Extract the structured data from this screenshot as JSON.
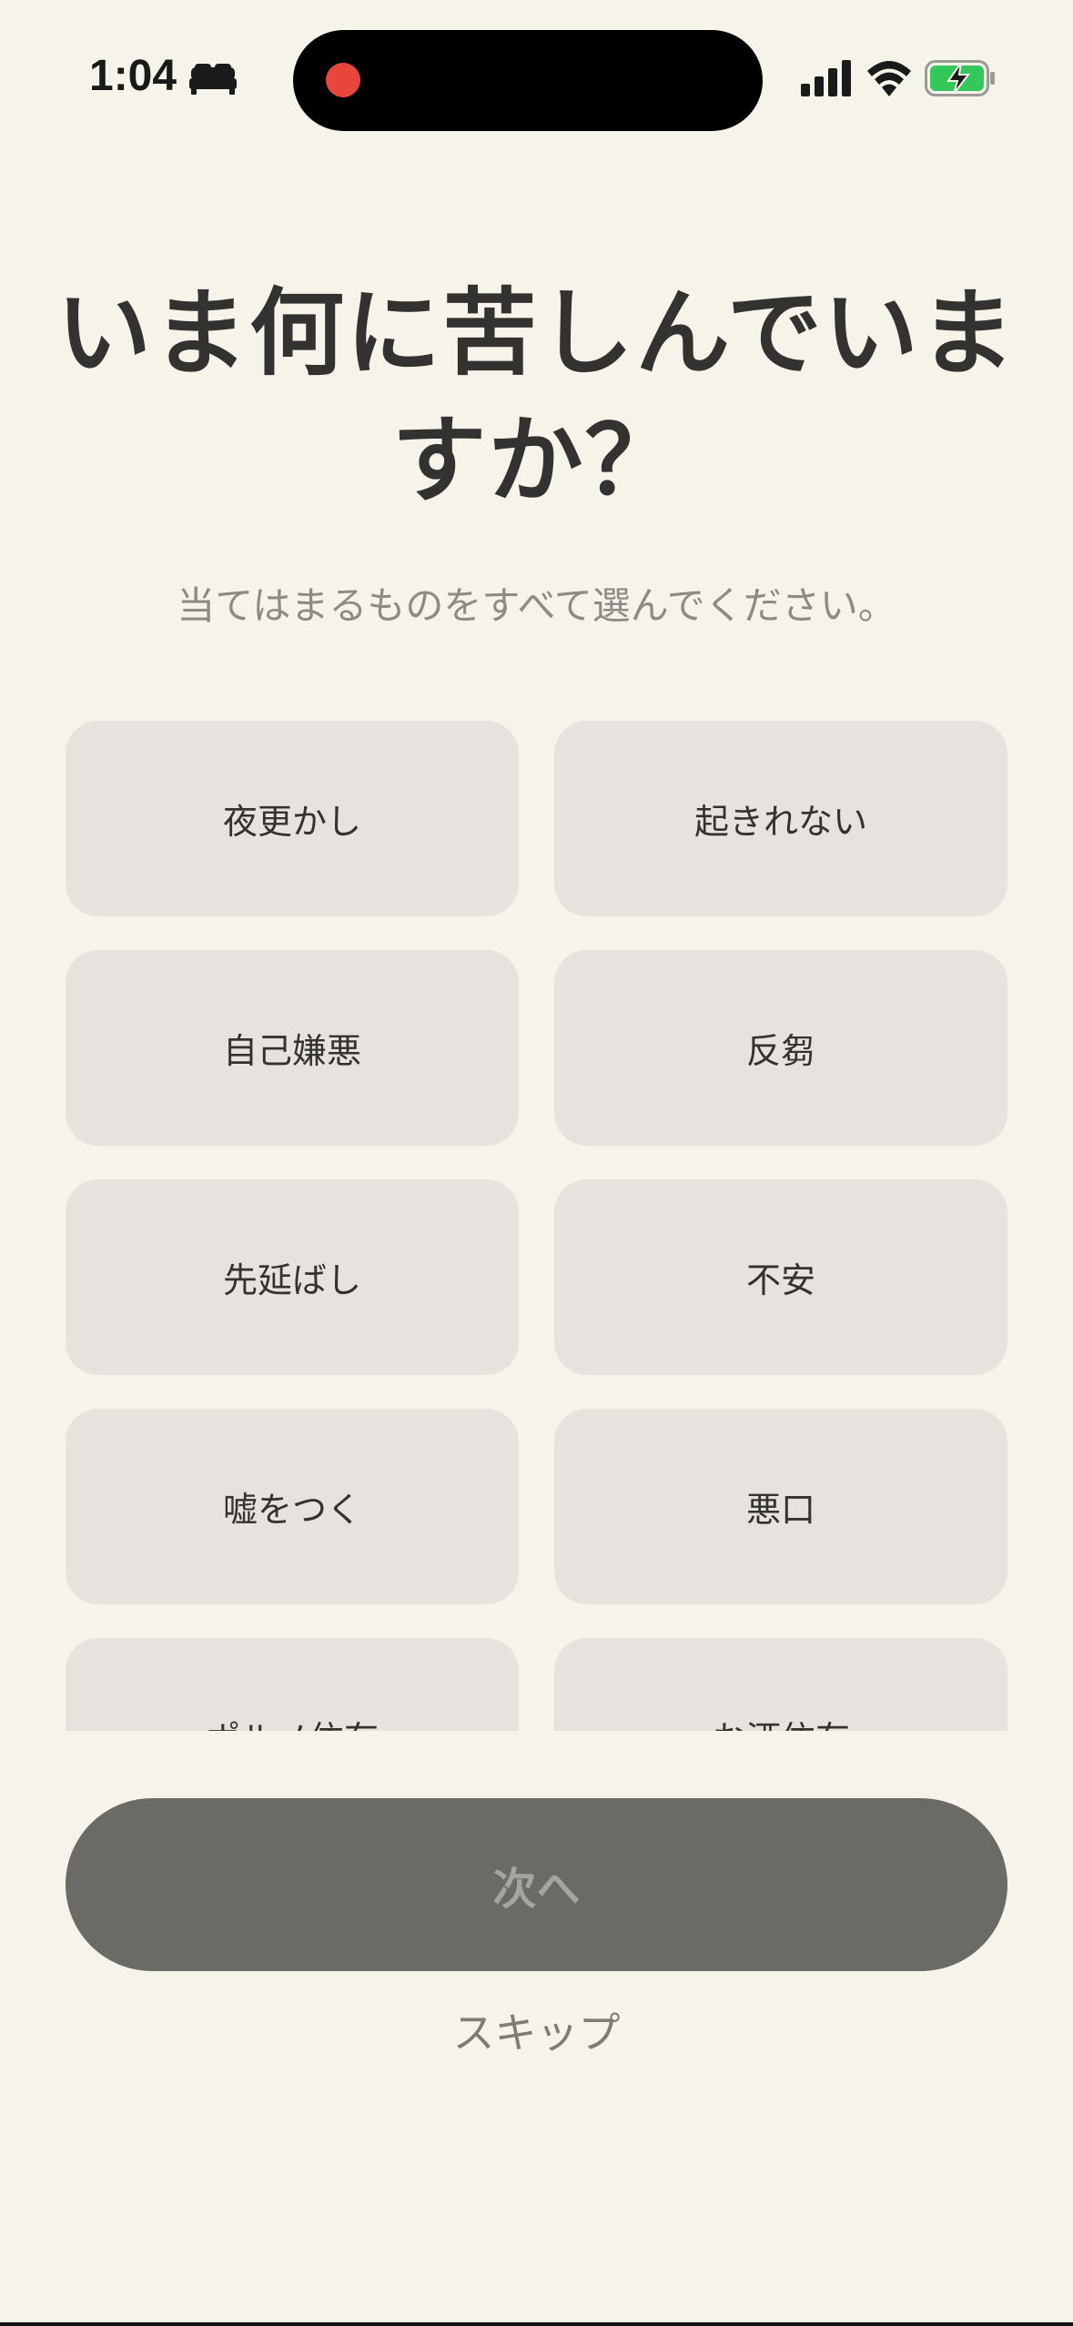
{
  "status_bar": {
    "time": "1:04",
    "sleep_icon": "bed-icon",
    "signal_icon": "cellular-signal-icon",
    "wifi_icon": "wifi-icon",
    "battery_icon": "battery-charging-icon",
    "recording_color": "#e8453c",
    "battery_color": "#34c759"
  },
  "header": {
    "title": "いま何に苦しんでいますか？",
    "subtitle": "当てはまるものをすべて選んでください。"
  },
  "options": [
    {
      "label": "夜更かし"
    },
    {
      "label": "起きれない"
    },
    {
      "label": "自己嫌悪"
    },
    {
      "label": "反芻"
    },
    {
      "label": "先延ばし"
    },
    {
      "label": "不安"
    },
    {
      "label": "嘘をつく"
    },
    {
      "label": "悪口"
    },
    {
      "label": "ポルノ依存"
    },
    {
      "label": "お酒依存"
    }
  ],
  "footer": {
    "next_label": "次へ",
    "skip_label": "スキップ"
  },
  "colors": {
    "background": "#f5f3ea",
    "card": "#e6e3de",
    "button_disabled": "#6b6a67",
    "text_primary": "#333230",
    "text_secondary": "#8d8b86"
  }
}
